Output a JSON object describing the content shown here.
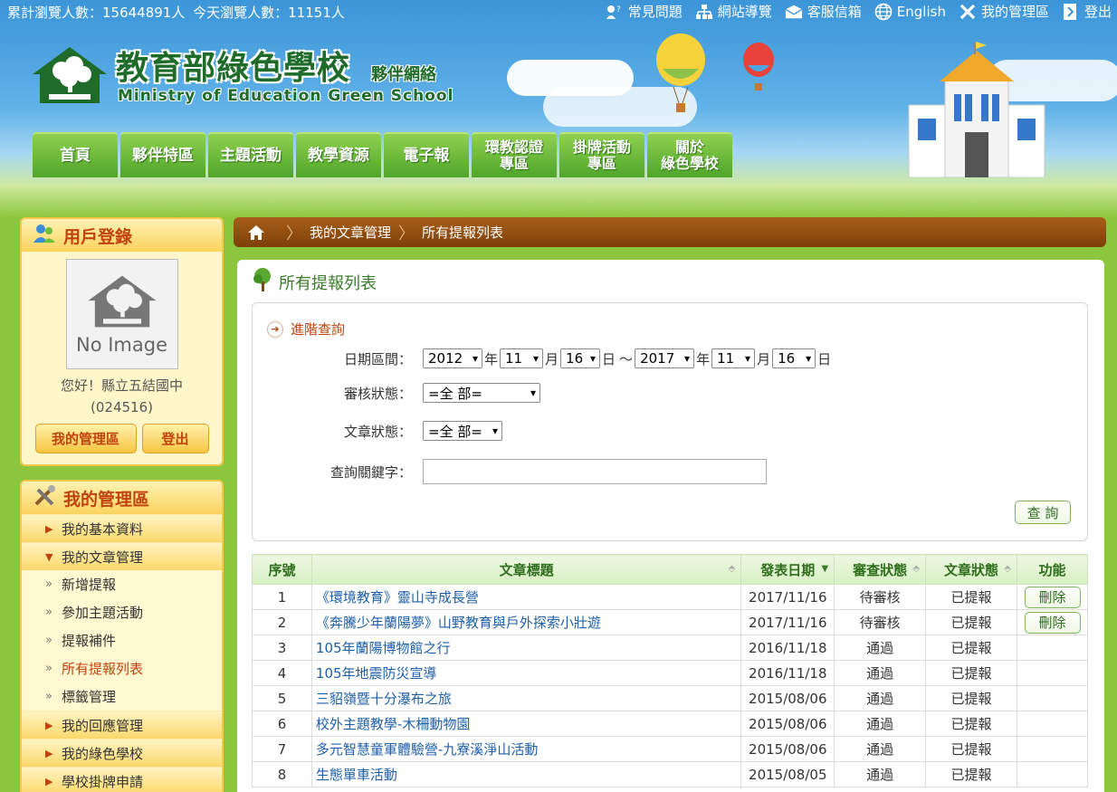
{
  "topbar": {
    "stats_total": "累計瀏覽人數：15644891人",
    "stats_today": "今天瀏覽人數：11151人",
    "links": [
      {
        "label": "常見問題",
        "icon": "question-icon"
      },
      {
        "label": "網站導覽",
        "icon": "sitemap-icon"
      },
      {
        "label": "客服信箱",
        "icon": "mail-icon"
      },
      {
        "label": "English",
        "icon": "globe-icon"
      },
      {
        "label": "我的管理區",
        "icon": "tools-icon"
      },
      {
        "label": "登出",
        "icon": "logout-icon"
      }
    ]
  },
  "header": {
    "title": "教育部綠色學校",
    "subtitle": "夥伴網絡",
    "english": "Ministry of Education Green School",
    "nav": [
      "首頁",
      "夥伴特區",
      "主題活動",
      "教學資源",
      "電子報",
      "環教認證\n專區",
      "掛牌活動\n專區",
      "關於\n綠色學校"
    ]
  },
  "login": {
    "title": "用戶登錄",
    "noimage": "No Image",
    "greeting": "您好！縣立五結國中",
    "code": "(024516)",
    "manage_btn": "我的管理區",
    "logout_btn": "登出"
  },
  "menu": {
    "title": "我的管理區",
    "items": [
      {
        "label": "我的基本資料",
        "tri": "▶"
      },
      {
        "label": "我的文章管理",
        "tri": "▼"
      }
    ],
    "subitems": [
      "新增提報",
      "參加主題活動",
      "提報補件",
      "所有提報列表",
      "標籤管理"
    ],
    "items_after": [
      {
        "label": "我的回應管理",
        "tri": "▶"
      },
      {
        "label": "我的綠色學校",
        "tri": "▶"
      },
      {
        "label": "學校掛牌申請",
        "tri": "▶"
      }
    ]
  },
  "breadcrumb": {
    "item1": "我的文章管理",
    "item2": "所有提報列表"
  },
  "page": {
    "title": "所有提報列表"
  },
  "search": {
    "advanced_label": "進階查詢",
    "date_label": "日期區間：",
    "from": {
      "year": "2012",
      "month": "11",
      "day": "16"
    },
    "to": {
      "year": "2017",
      "month": "11",
      "day": "16"
    },
    "unit_year": "年",
    "unit_month": "月",
    "unit_day": "日",
    "range_sep": "～",
    "review_label": "審核狀態：",
    "review_value": "=全 部=",
    "article_label": "文章狀態：",
    "article_value": "=全 部=",
    "keyword_label": "查詢關鍵字：",
    "keyword_value": "",
    "query_btn": "查 詢"
  },
  "table": {
    "headers": {
      "no": "序號",
      "title": "文章標題",
      "date": "發表日期",
      "review": "審查狀態",
      "status": "文章狀態",
      "func": "功能"
    },
    "delete_label": "刪除",
    "rows": [
      {
        "no": "1",
        "title": "《環境教育》靈山寺成長營",
        "date": "2017/11/16",
        "review": "待審核",
        "status": "已提報",
        "del": true
      },
      {
        "no": "2",
        "title": "《奔騰少年蘭陽夢》山野教育與戶外探索小壯遊",
        "date": "2017/11/16",
        "review": "待審核",
        "status": "已提報",
        "del": true
      },
      {
        "no": "3",
        "title": "105年蘭陽博物館之行",
        "date": "2016/11/18",
        "review": "通過",
        "status": "已提報",
        "del": false
      },
      {
        "no": "4",
        "title": "105年地震防災宣導",
        "date": "2016/11/18",
        "review": "通過",
        "status": "已提報",
        "del": false
      },
      {
        "no": "5",
        "title": "三貂嶺暨十分瀑布之旅",
        "date": "2015/08/06",
        "review": "通過",
        "status": "已提報",
        "del": false
      },
      {
        "no": "6",
        "title": "校外主題教學-木柵動物園",
        "date": "2015/08/06",
        "review": "通過",
        "status": "已提報",
        "del": false
      },
      {
        "no": "7",
        "title": "多元智慧童軍體驗營-九寮溪淨山活動",
        "date": "2015/08/06",
        "review": "通過",
        "status": "已提報",
        "del": false
      },
      {
        "no": "8",
        "title": "生態單車活動",
        "date": "2015/08/05",
        "review": "通過",
        "status": "已提報",
        "del": false
      }
    ]
  }
}
